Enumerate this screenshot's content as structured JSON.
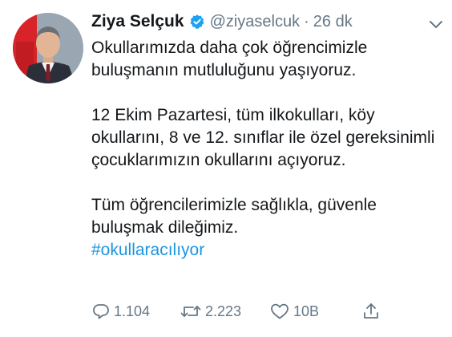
{
  "tweet": {
    "author_name": "Ziya Selçuk",
    "handle": "@ziyaselcuk",
    "separator": "·",
    "time": "26 dk",
    "text_lines": {
      "p1": "Okullarımızda daha çok öğrencimizle buluşmanın mutluluğunu yaşıyoruz.",
      "p2": "12 Ekim Pazartesi, tüm ilkokulları, köy okullarını, 8 ve 12. sınıflar ile özel gereksinimli çocuklarımızın okullarını açıyoruz.",
      "p3": "Tüm öğrencilerimizle sağlıkla, güvenle buluşmak dileğimiz."
    },
    "hashtag": "#okullaracılıyor"
  },
  "actions": {
    "reply_count": "1.104",
    "retweet_count": "2.223",
    "like_count": "10B"
  },
  "icons": {
    "verified": "verified-badge-icon",
    "menu": "chevron-down-icon",
    "reply": "reply-icon",
    "retweet": "retweet-icon",
    "like": "heart-icon",
    "share": "share-icon"
  },
  "colors": {
    "text": "#14171a",
    "secondary": "#657786",
    "link": "#1b95e0",
    "verified": "#1da1f2"
  }
}
